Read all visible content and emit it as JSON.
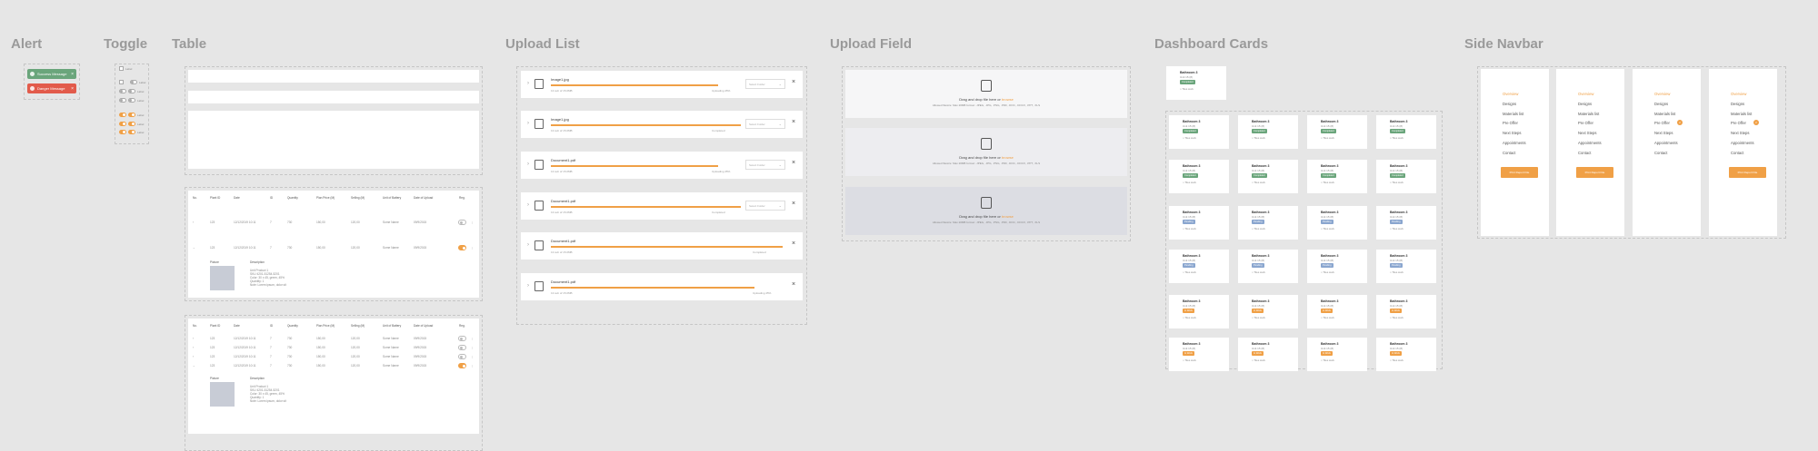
{
  "titles": {
    "alert": "Alert",
    "toggle": "Toggle",
    "table": "Table",
    "upload_list": "Upload List",
    "upload_field": "Upload Field",
    "dashboard_cards": "Dashboard Cards",
    "side_navbar": "Side Navbar"
  },
  "colors": {
    "accent": "#f0a046",
    "success": "#6aa57b",
    "danger": "#e25b4b",
    "info": "#8aa6cf"
  },
  "alerts": [
    {
      "text": "Success Message",
      "type": "success"
    },
    {
      "text": "Danger Message",
      "type": "danger"
    }
  ],
  "toggle_labels": {
    "checkbox": "Label",
    "switch": "Label"
  },
  "table": {
    "headers": [
      "No.",
      "Plant ID",
      "Date",
      "ID",
      "Quantity",
      "Plan Price (M)",
      "Selling (M)",
      "Unit of Battery",
      "Date of Upload",
      "Reg."
    ],
    "rows": [
      [
        "1",
        "123",
        "12/12/2019 10:11",
        "7",
        "730",
        "150,00",
        "120,00",
        "Some Name",
        "09/9/2015"
      ],
      [
        "2",
        "123",
        "12/12/2019 10:11",
        "7",
        "730",
        "150,00",
        "120,00",
        "Some Name",
        "09/9/2015"
      ],
      [
        "3",
        "123",
        "12/12/2019 10:11",
        "7",
        "730",
        "150,00",
        "120,00",
        "Some Name",
        "09/9/2015"
      ],
      [
        "4",
        "123",
        "12/12/2019 10:11",
        "7",
        "730",
        "150,00",
        "120,00",
        "Some Name",
        "09/9/2015"
      ]
    ],
    "detail_image_label": "Picture",
    "detail_desc_label": "Description",
    "detail_desc_lines": [
      "Unit Product 1",
      "SKU 4201-51254-5201",
      "Color: 30 x 45, green, 45%",
      "Quantity: 1",
      "Note: Lorem ipsum, dolor sit"
    ]
  },
  "upload_list": [
    {
      "name": "Image1.jpg",
      "meta": "13 sub of 15.0MB",
      "status": "Uploading 45%",
      "select": "Select Folder",
      "progress": 0.72
    },
    {
      "name": "Image1.jpg",
      "meta": "13 sub of 15.0MB",
      "status": "Completed",
      "select": "Select Folder",
      "progress": 0.82
    },
    {
      "name": "Document1.pdf",
      "meta": "13 sub of 15.0MB",
      "status": "Uploading 45%",
      "select": "Select Folder",
      "progress": 0.72
    },
    {
      "name": "Document1.pdf",
      "meta": "13 sub of 15.0MB",
      "status": "Completed",
      "select": "Select Folder",
      "progress": 0.82
    },
    {
      "name": "Document1.pdf",
      "meta": "13 sub of 15.0MB",
      "status": "Completed",
      "select": "",
      "progress": 1.0
    },
    {
      "name": "Document1.pdf",
      "meta": "13 sub of 15.0MB",
      "status": "Uploading 45%",
      "select": "",
      "progress": 0.88
    }
  ],
  "upload_field": {
    "drag_text": "Drag and drop file here or",
    "browse_text": "browse",
    "allowed_text": "Allowed filesize: Max 20MB format: .JPEG, .JPG, .PNG, .PDF, .DOC, .DOCX, .PPT, .XLS"
  },
  "dashboard_cards": {
    "title": "Bathroom 3",
    "subtitle": "Unit 15 (8)",
    "location": "Tiles work",
    "badges": [
      "Completed",
      "Pending",
      "In Work"
    ]
  },
  "side_navbar": {
    "items": [
      "Overview",
      "Designs",
      "Materials list",
      "Pre Offer",
      "Next Steps",
      "Appointments",
      "Contact"
    ],
    "badge": "2",
    "button": "Print Report File"
  }
}
